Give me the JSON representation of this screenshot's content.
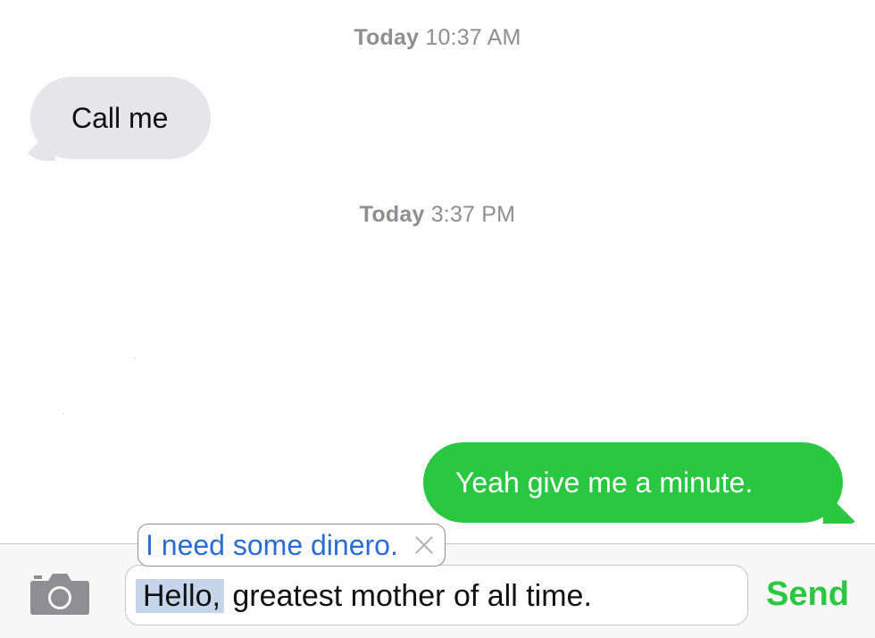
{
  "thread": {
    "timestamps": [
      {
        "day": "Today",
        "time": "10:37 AM"
      },
      {
        "day": "Today",
        "time": "3:37 PM"
      }
    ],
    "messages": [
      {
        "direction": "incoming",
        "text": "Call me"
      },
      {
        "direction": "outgoing",
        "text": "Yeah give me a minute."
      }
    ]
  },
  "autocorrect": {
    "suggestion": "I need some dinero."
  },
  "composer": {
    "selected_text": "Hello,",
    "remaining_text": " greatest mother of all time.",
    "send_label": "Send",
    "camera_icon": "camera-icon"
  },
  "colors": {
    "incoming_bubble": "#e5e5ea",
    "outgoing_bubble": "#2ac840",
    "send": "#2ac840",
    "suggestion_text": "#2a6cd6",
    "selection": "#c5d6ea"
  }
}
